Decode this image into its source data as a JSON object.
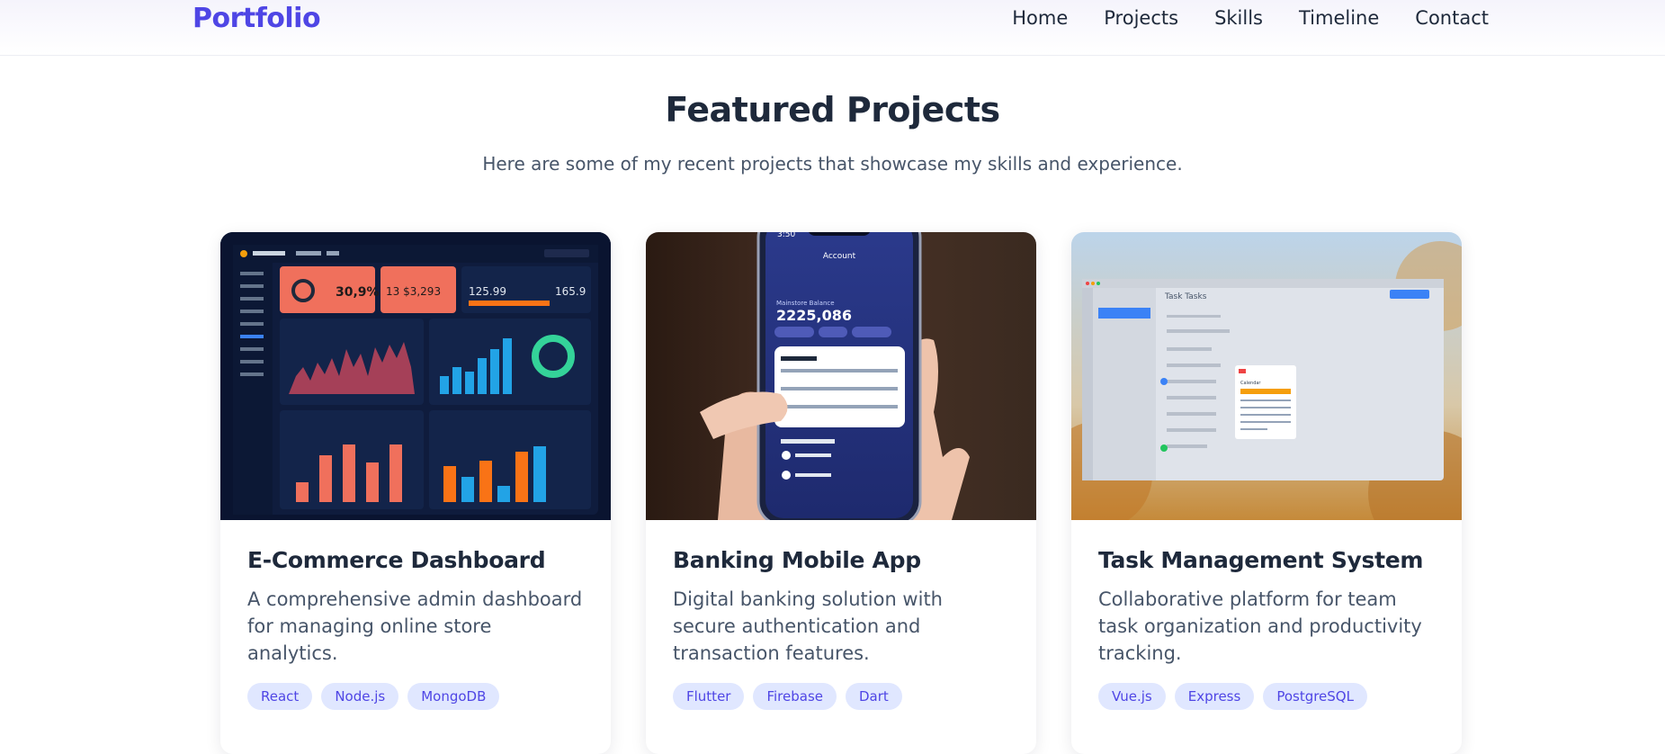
{
  "header": {
    "logo": "Portfolio",
    "nav": [
      "Home",
      "Projects",
      "Skills",
      "Timeline",
      "Contact"
    ]
  },
  "section": {
    "title": "Featured Projects",
    "subtitle": "Here are some of my recent projects that showcase my skills and experience."
  },
  "projects": [
    {
      "title": "E-Commerce Dashboard",
      "description": "A comprehensive admin dashboard for managing online store analytics.",
      "tags": [
        "React",
        "Node.js",
        "MongoDB"
      ],
      "image_icon": "dashboard-screenshot"
    },
    {
      "title": "Banking Mobile App",
      "description": "Digital banking solution with secure authentication and transaction features.",
      "tags": [
        "Flutter",
        "Firebase",
        "Dart"
      ],
      "image_icon": "phone-app-photo",
      "phone_screen": {
        "time": "3:50",
        "header": "Account",
        "balance_label": "Mainstore Balance",
        "balance": "2225,086"
      }
    },
    {
      "title": "Task Management System",
      "description": "Collaborative platform for team task organization and productivity tracking.",
      "tags": [
        "Vue.js",
        "Express",
        "PostgreSQL"
      ],
      "image_icon": "task-app-screenshot",
      "app_screen": {
        "heading": "Task Tasks",
        "calendar_label": "Calendar"
      }
    }
  ],
  "colors": {
    "accent": "#4f46e5",
    "tag_bg": "#e0e7ff",
    "heading": "#1e293b",
    "body_text": "#475569"
  }
}
